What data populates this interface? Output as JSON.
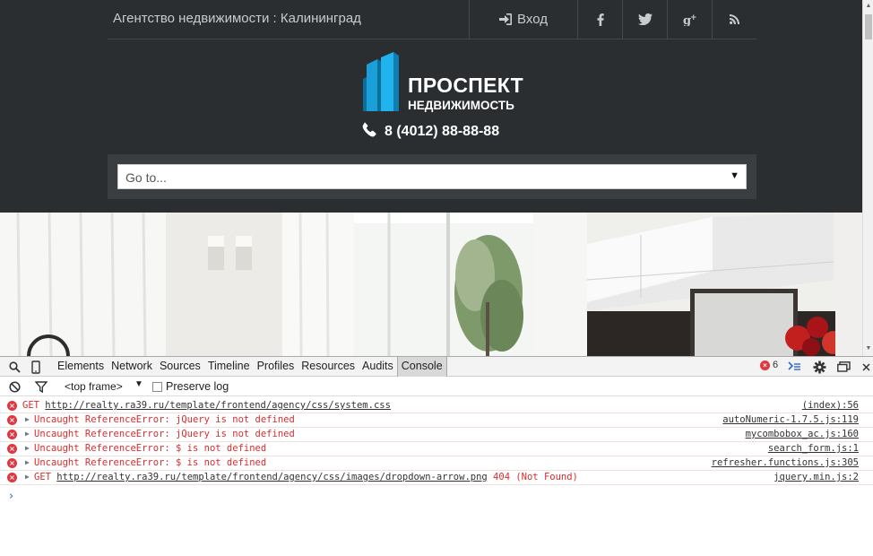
{
  "site": {
    "agency_title": "Агентство недвижимости : Калининград",
    "login_label": "Вход",
    "social": [
      "facebook-icon",
      "twitter-icon",
      "google-plus-icon",
      "rss-icon"
    ],
    "logo_name": "ПРОСПЕКТ",
    "logo_sub": "НЕДВИЖИМОСТЬ",
    "phone": "8 (4012) 88-88-88",
    "goto_placeholder": "Go to...",
    "colors": {
      "header_bg": "#2b2e30",
      "logo_blue": "#1a9fd8"
    }
  },
  "devtools": {
    "tabs": [
      "Elements",
      "Network",
      "Sources",
      "Timeline",
      "Profiles",
      "Resources",
      "Audits",
      "Console"
    ],
    "active_tab": "Console",
    "error_count": "6",
    "frame_label": "<top frame>",
    "preserve_log_label": "Preserve log",
    "console_lines": [
      {
        "prefix": "GET ",
        "url": "http://realty.ra39.ru/template/frontend/agency/css/system.css",
        "suffix": "",
        "expandable": false,
        "source": "(index):56"
      },
      {
        "prefix": "Uncaught ReferenceError: jQuery is not defined",
        "url": "",
        "suffix": "",
        "expandable": true,
        "source": "autoNumeric-1.7.5.js:119"
      },
      {
        "prefix": "Uncaught ReferenceError: jQuery is not defined",
        "url": "",
        "suffix": "",
        "expandable": true,
        "source": "mycombobox_ac.js:160"
      },
      {
        "prefix": "Uncaught ReferenceError: $ is not defined",
        "url": "",
        "suffix": "",
        "expandable": true,
        "source": "search_form.js:1"
      },
      {
        "prefix": "Uncaught ReferenceError: $ is not defined",
        "url": "",
        "suffix": "",
        "expandable": true,
        "source": "refresher.functions.js:305"
      },
      {
        "prefix": "GET ",
        "url": "http://realty.ra39.ru/template/frontend/agency/css/images/dropdown-arrow.png",
        "suffix": " 404 (Not Found)",
        "expandable": true,
        "source": "jquery.min.js:2"
      }
    ],
    "prompt_symbol": "›"
  }
}
